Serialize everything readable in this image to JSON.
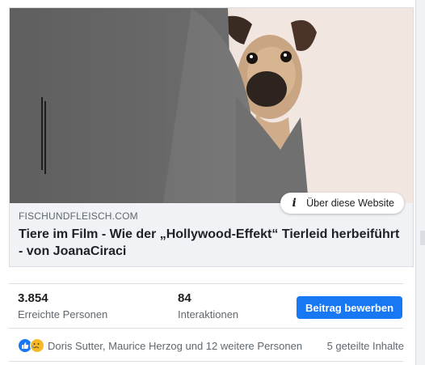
{
  "preview": {
    "image_alt": "Mops schaut hinter grauem Sessel hervor",
    "about_label": "Über diese Website",
    "domain": "FISCHUNDFLEISCH.COM",
    "title": "Tiere im Film - Wie der „Hollywood-Effekt“ Tierleid herbeiführt - von JoanaCiraci"
  },
  "stats": {
    "reach_value": "3.854",
    "reach_label": "Erreichte Personen",
    "interactions_value": "84",
    "interactions_label": "Interaktionen"
  },
  "boost_button": "Beitrag bewerben",
  "reactions": {
    "icons": [
      "like-icon",
      "sad-icon"
    ],
    "names": "Doris Sutter, Maurice Herzog und 12 weitere Personen",
    "shares": "5 geteilte Inhalte"
  },
  "colors": {
    "accent": "#1877f2",
    "muted_text": "#606770",
    "border": "#dadde1"
  }
}
